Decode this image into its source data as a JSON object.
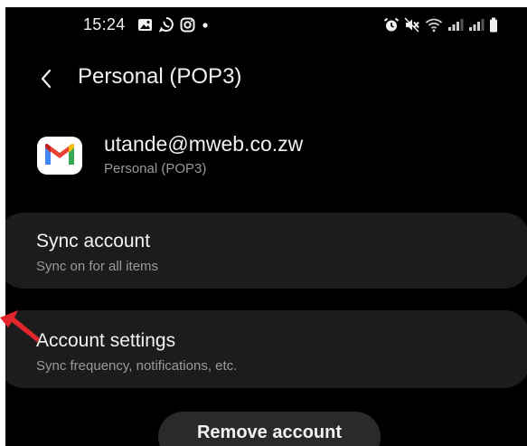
{
  "status_bar": {
    "time": "15:24",
    "left_icons": [
      "gallery-icon",
      "whatsapp-icon",
      "instagram-icon",
      "notification-dot-icon"
    ],
    "right_icons": [
      "alarm-icon",
      "mute-icon",
      "wifi-icon",
      "signal-1-icon",
      "signal-2-icon",
      "battery-icon"
    ]
  },
  "header": {
    "title": "Personal (POP3)"
  },
  "account": {
    "email": "utande@mweb.co.zw",
    "type": "Personal (POP3)"
  },
  "sync_card": {
    "title": "Sync account",
    "subtitle": "Sync on for all items"
  },
  "settings_card": {
    "title": "Account settings",
    "subtitle": "Sync frequency, notifications, etc."
  },
  "remove_button": {
    "label": "Remove account"
  },
  "colors": {
    "background": "#000000",
    "card": "#1c1c1c",
    "primary_text": "#f2f2f2",
    "secondary_text": "#9a9a9a",
    "annotation_arrow": "#e3262c"
  }
}
